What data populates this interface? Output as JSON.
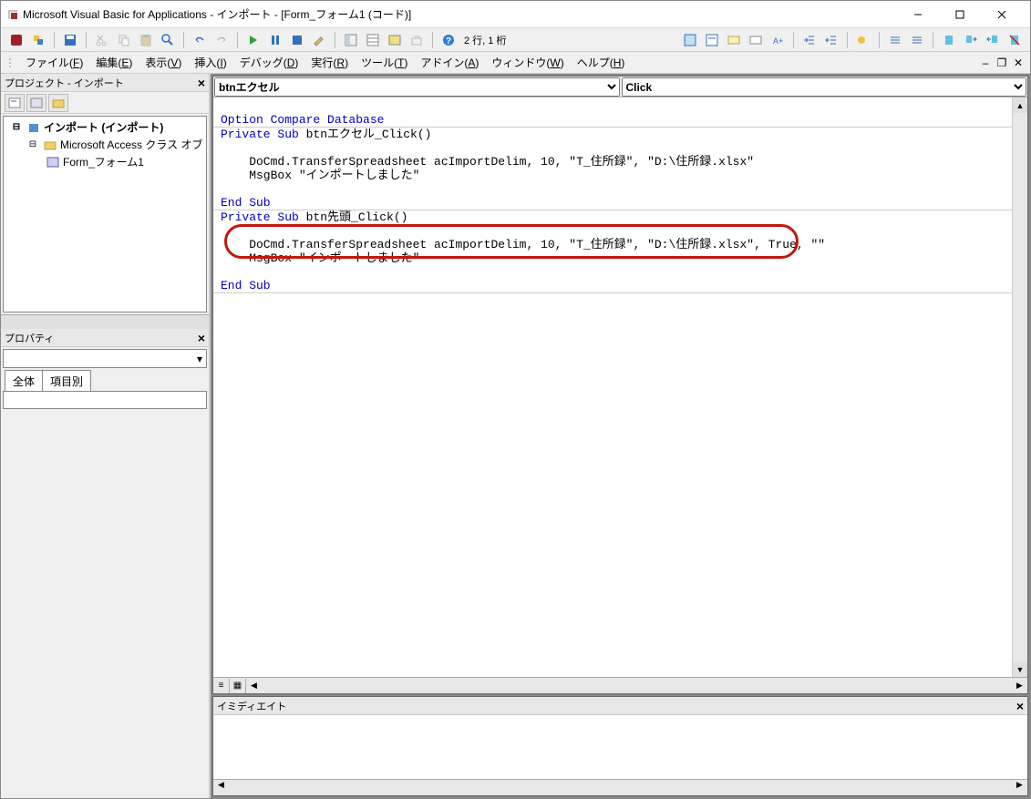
{
  "title": "Microsoft Visual Basic for Applications - インポート - [Form_フォーム1 (コード)]",
  "cursor_position": "2 行, 1 桁",
  "menus": [
    "ファイル(F)",
    "編集(E)",
    "表示(V)",
    "挿入(I)",
    "デバッグ(D)",
    "実行(R)",
    "ツール(T)",
    "アドイン(A)",
    "ウィンドウ(W)",
    "ヘルプ(H)"
  ],
  "project_panel": {
    "title": "プロジェクト - インポート",
    "tree": {
      "root": "インポート (インポート)",
      "folder": "Microsoft Access クラス オブ",
      "item": "Form_フォーム1"
    }
  },
  "props_panel": {
    "title": "プロパティ",
    "tabs": [
      "全体",
      "項目別"
    ]
  },
  "combos": {
    "object": "btnエクセル",
    "proc": "Click"
  },
  "code": {
    "l1": "Option Compare Database",
    "l2": "Private Sub btnエクセル_Click()",
    "l3": "    DoCmd.TransferSpreadsheet acImportDelim, 10, \"T_住所録\", \"D:\\住所録.xlsx\"",
    "l4": "    MsgBox \"インポートしました\"",
    "l5": "End Sub",
    "l6": "Private Sub btn先頭_Click()",
    "l7": "    DoCmd.TransferSpreadsheet acImportDelim, 10, \"T_住所録\", \"D:\\住所録.xlsx\", True, \"\"",
    "l8": "    MsgBox \"インポートしました\"",
    "l9": "End Sub"
  },
  "immediate": {
    "title": "イミディエイト"
  }
}
